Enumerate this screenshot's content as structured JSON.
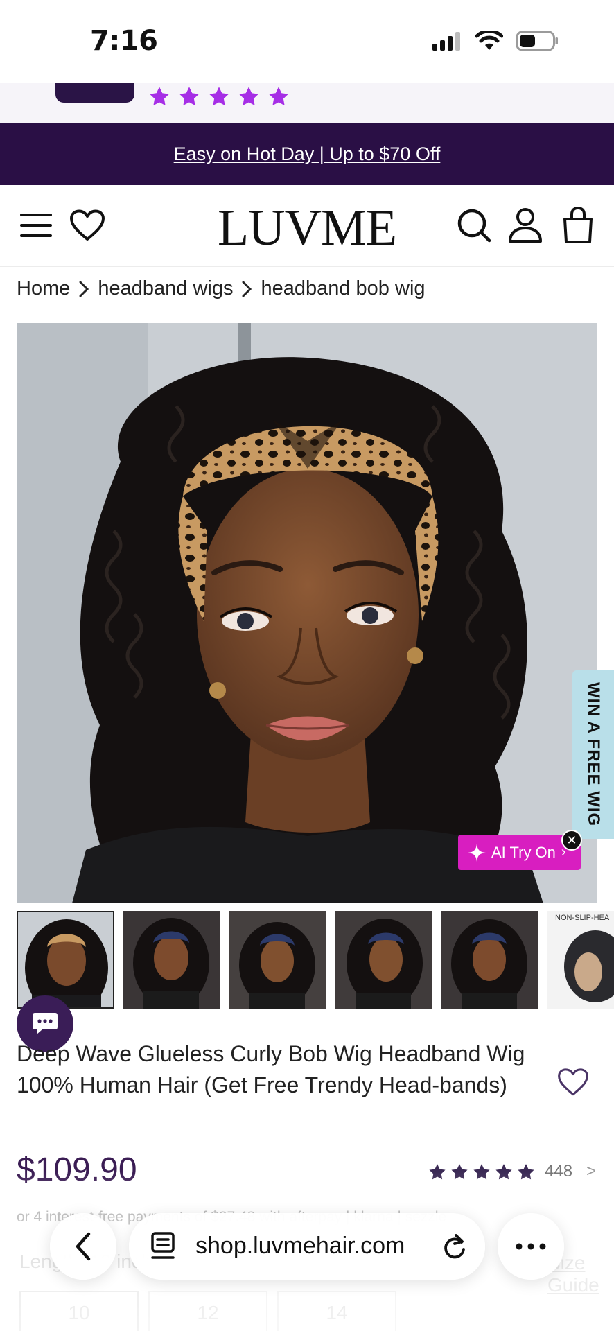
{
  "status_bar": {
    "time": "7:16",
    "icons": [
      "signal-icon",
      "wifi-icon",
      "battery-icon"
    ]
  },
  "review_strip": {
    "rating": 5,
    "star_color": "#a62ee6"
  },
  "promo": {
    "text": "Easy on Hot Day | Up to $70 Off",
    "background": "#2a0f45"
  },
  "header": {
    "logo": "LUVME",
    "icons": [
      "menu-icon",
      "heart-icon",
      "search-icon",
      "account-icon",
      "bag-icon"
    ]
  },
  "breadcrumb": [
    "Home",
    "headband wigs",
    "headband bob wig"
  ],
  "hero": {
    "side_tab": "WIN A FREE WIG",
    "ai_try_on": "AI Try On",
    "ai_try_on_color": "#d81ec0"
  },
  "thumbnails": {
    "count_visible": 6,
    "last_label": "NON-SLIP-HEA"
  },
  "product": {
    "title": "Deep Wave Glueless Curly Bob Wig Headband Wig 100% Human Hair (Get Free Trendy Head-bands)",
    "price": "$109.90",
    "rating": 5,
    "review_count": "448",
    "installments": "or 4 interest-free payments of $27.48 with afterpay | klarna | sezzle",
    "length_label": "Length: 10 inches",
    "size_guide": "Size Guide",
    "lengths": [
      "10",
      "12",
      "14"
    ]
  },
  "browser": {
    "url": "shop.luvmehair.com",
    "icons": [
      "back-icon",
      "page-icon",
      "reload-icon",
      "more-icon"
    ]
  },
  "colors": {
    "brand_dark": "#2a0f45",
    "price": "#3b1d54",
    "stars": "#3b2a55"
  }
}
